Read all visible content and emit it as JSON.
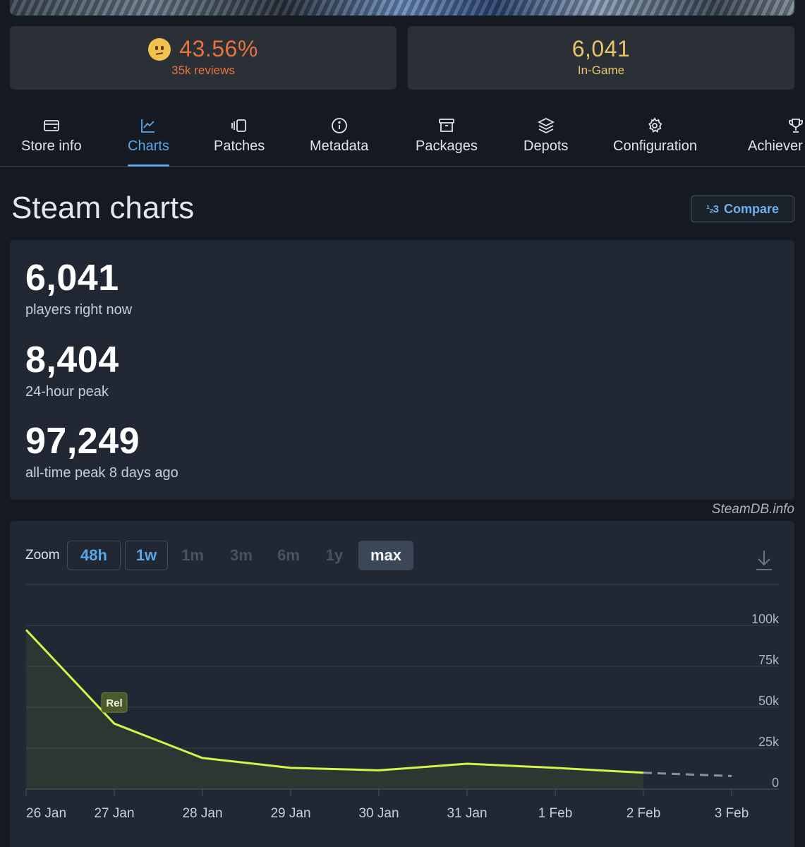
{
  "summary": {
    "rating_percent": "43.56%",
    "reviews": "35k reviews",
    "ingame_value": "6,041",
    "ingame_label": "In-Game"
  },
  "tabs": [
    {
      "label": "Store info",
      "icon": "card-icon"
    },
    {
      "label": "Charts",
      "icon": "chart-icon",
      "active": true
    },
    {
      "label": "Patches",
      "icon": "patches-icon"
    },
    {
      "label": "Metadata",
      "icon": "info-icon"
    },
    {
      "label": "Packages",
      "icon": "archive-icon"
    },
    {
      "label": "Depots",
      "icon": "layers-icon"
    },
    {
      "label": "Configuration",
      "icon": "gear-icon"
    },
    {
      "label": "Achiever",
      "icon": "trophy-icon"
    }
  ],
  "page": {
    "title": "Steam charts",
    "compare_label": "Compare",
    "compare_icon": "1/2 3"
  },
  "stats": [
    {
      "value": "6,041",
      "caption": "players right now"
    },
    {
      "value": "8,404",
      "caption": "24-hour peak"
    },
    {
      "value": "97,249",
      "caption": "all-time peak 8 days ago"
    }
  ],
  "credit": "SteamDB.info",
  "zoom": {
    "label": "Zoom",
    "options": [
      {
        "label": "48h",
        "state": "on"
      },
      {
        "label": "1w",
        "state": "on"
      },
      {
        "label": "1m",
        "state": "off"
      },
      {
        "label": "3m",
        "state": "off"
      },
      {
        "label": "6m",
        "state": "off"
      },
      {
        "label": "1y",
        "state": "off"
      },
      {
        "label": "max",
        "state": "selected"
      }
    ]
  },
  "colors": {
    "accent": "#5aa7e6",
    "rating": "#e8733e",
    "ingame": "#e6c56a",
    "line": "#d4f44a"
  },
  "chart_data": {
    "type": "line",
    "x": [
      "26 Jan",
      "27 Jan",
      "28 Jan",
      "29 Jan",
      "30 Jan",
      "31 Jan",
      "1 Feb",
      "2 Feb",
      "3 Feb"
    ],
    "series": [
      {
        "values": [
          97249,
          40000,
          19000,
          13000,
          11500,
          15500,
          13000,
          10000,
          null
        ]
      }
    ],
    "projection": {
      "from": "2 Feb",
      "to": "3 Feb",
      "values": [
        10000,
        8000
      ]
    },
    "yticks": [
      "0",
      "25k",
      "50k",
      "75k",
      "100k"
    ],
    "ylim": [
      0,
      100000
    ],
    "annotation": {
      "x": "27 Jan",
      "label": "Rel"
    }
  }
}
